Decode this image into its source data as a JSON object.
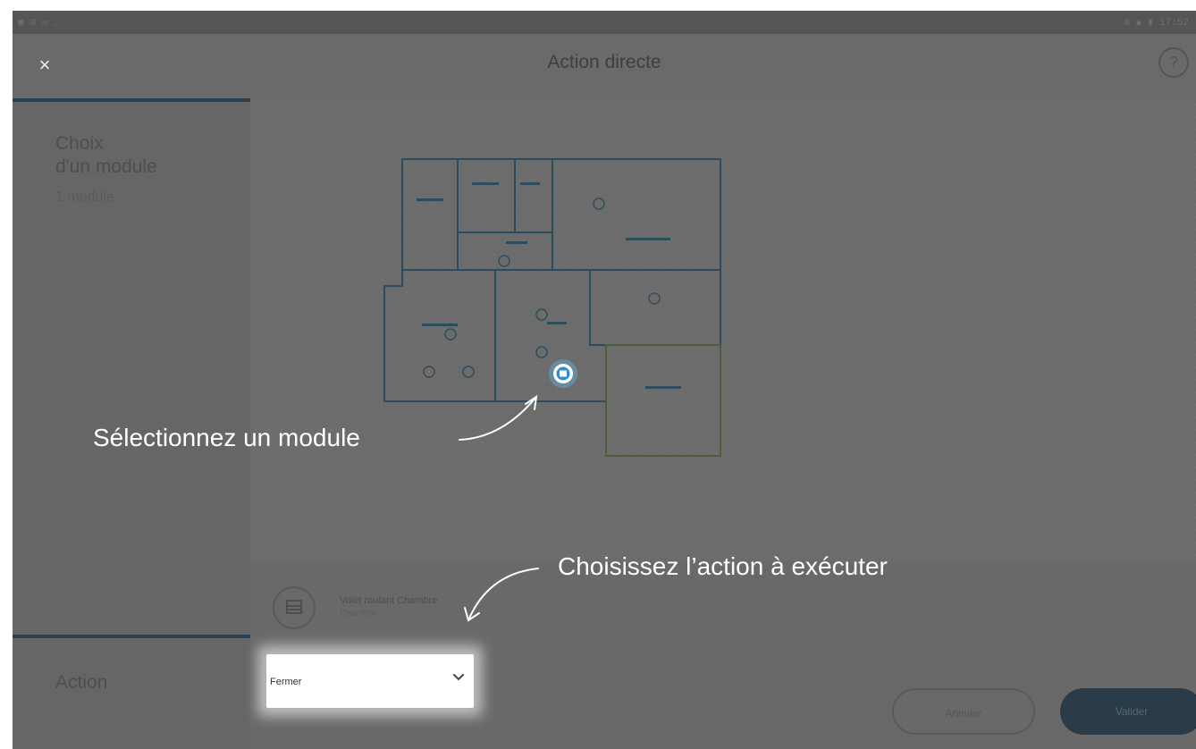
{
  "status_bar": {
    "left": "▣ ⊡ ✉ …",
    "right": "⚙ ▲ ▮ 17:52"
  },
  "header": {
    "close_label": "×",
    "title": "Action directe",
    "help_label": "?"
  },
  "sidebar": {
    "step1_title_line1": "Choix",
    "step1_title_line2": "d'un module",
    "step1_subtitle": "1 module",
    "step2_title": "Action"
  },
  "module": {
    "name": "Volet roulant Chambre",
    "room": "Chambre"
  },
  "action_select": {
    "value": "Fermer"
  },
  "buttons": {
    "cancel": "Annuler",
    "validate": "Valider"
  },
  "callouts": {
    "select_module": "Sélectionnez un module",
    "choose_action": "Choisissez l’action à exécuter"
  },
  "colors": {
    "overlay": "#6a6a6a",
    "accent": "#2b4050",
    "selected_module": "#5cc8ff",
    "plan_lines": "#2b4c5e"
  }
}
